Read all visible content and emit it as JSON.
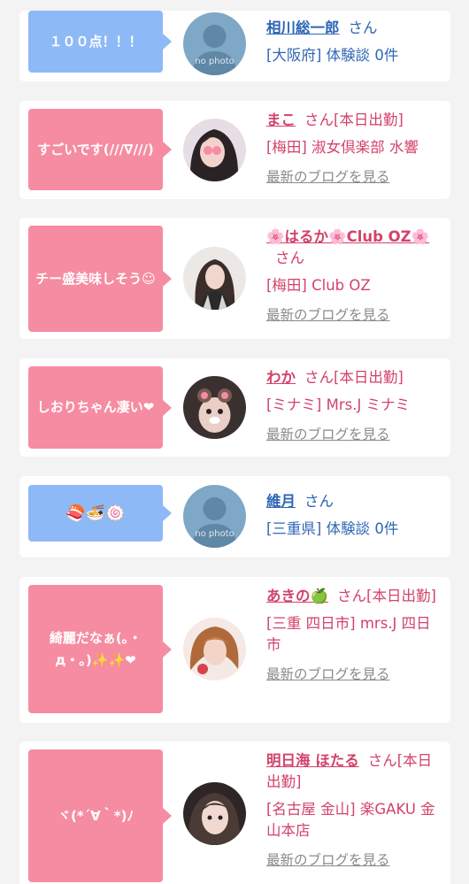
{
  "entries": [
    {
      "bubble": "１００点！！！",
      "bubble_color": "blue",
      "avatar": "no-photo",
      "no_photo_label": "no photo",
      "name": "相川総一郎",
      "suffix": "さん",
      "detail": "[大阪府] 体験談 0件"
    },
    {
      "bubble": "すごいです(///∇///)",
      "bubble_color": "pink",
      "avatar": "photo",
      "name": "まこ",
      "suffix": "さん[本日出勤]",
      "detail": "[梅田] 淑女倶楽部 水響",
      "blog": "最新のブログを見る"
    },
    {
      "bubble": "チー盛美味しそう☺",
      "bubble_color": "pink",
      "avatar": "photo",
      "name": "🌸はるか🌸Club OZ🌸",
      "suffix": "さん",
      "detail": "[梅田] Club OZ",
      "blog": "最新のブログを見る"
    },
    {
      "bubble": "しおりちゃん凄い❤",
      "bubble_color": "pink",
      "avatar": "photo",
      "name": "わか",
      "suffix": "さん[本日出勤]",
      "detail": "[ミナミ] Mrs.J ミナミ",
      "blog": "最新のブログを見る"
    },
    {
      "bubble": "🍣🍜🍥",
      "bubble_color": "blue",
      "avatar": "no-photo",
      "no_photo_label": "no photo",
      "name": "維月",
      "suffix": "さん",
      "detail": "[三重県] 体験談 0件"
    },
    {
      "bubble": "綺麗だなぁ(｡・д・｡)✨✨❤",
      "bubble_color": "pink",
      "avatar": "photo",
      "name": "あきの🍏",
      "suffix": "さん[本日出勤]",
      "detail": "[三重 四日市] mrs.J 四日市",
      "blog": "最新のブログを見る"
    },
    {
      "bubble": "ヾ(*´∀｀*)ﾉ",
      "bubble_color": "pink",
      "avatar": "photo",
      "name": "明日海 ほたる",
      "suffix": "さん[本日出勤]",
      "detail": "[名古屋 金山] 楽GAKU 金山本店",
      "blog": "最新のブログを見る"
    }
  ],
  "colors": {
    "bubble_blue": "#8db9f7",
    "bubble_pink": "#f58ca2",
    "name_blue": "#2f67b6",
    "name_pink": "#d2436a",
    "link_gray": "#8a8a8a"
  }
}
